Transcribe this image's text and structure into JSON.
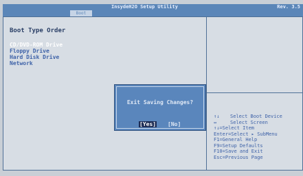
{
  "header": {
    "title": "InsydeH2O Setup Utility",
    "rev": "Rev. 3.5",
    "active_tab": "Boot"
  },
  "boot": {
    "section_title": "Boot Type Order",
    "items": [
      {
        "label": "CD/DVD-ROM Drive",
        "selected": true
      },
      {
        "label": "Floppy Drive",
        "selected": false
      },
      {
        "label": "Hard Disk Drive",
        "selected": false
      },
      {
        "label": "Network",
        "selected": false
      }
    ]
  },
  "dialog": {
    "message": "Exit Saving Changes?",
    "yes_label": "[Yes]",
    "no_label": "[No]"
  },
  "help": {
    "items": [
      {
        "key": "↑↓",
        "desc": "Select Boot Device"
      },
      {
        "key": "↔",
        "desc": "Select Screen"
      },
      {
        "key": "",
        "desc": "↑↓=Select Item"
      },
      {
        "key": "",
        "desc": "Enter=Select ▸ SubMenu"
      },
      {
        "key": "",
        "desc": "F1=General Help"
      },
      {
        "key": "",
        "desc": "F9=Setup Defaults"
      },
      {
        "key": "",
        "desc": "F10=Save and Exit"
      },
      {
        "key": "",
        "desc": "Esc=Previous Page"
      }
    ]
  }
}
